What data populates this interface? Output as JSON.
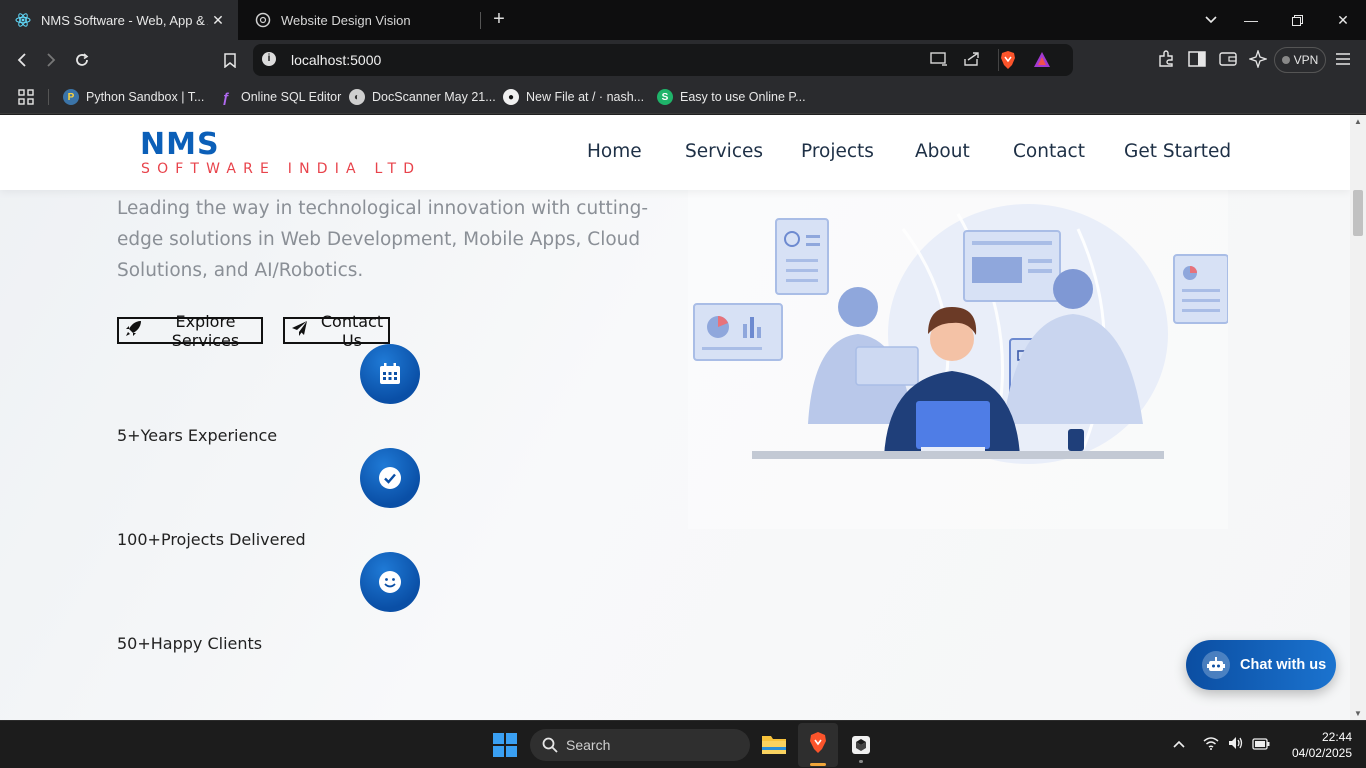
{
  "browser": {
    "tabs": [
      {
        "title": "NMS Software - Web, App & AI",
        "active": true
      },
      {
        "title": "Website Design Vision",
        "active": false
      }
    ],
    "url": "localhost:5000",
    "vpn_label": "VPN",
    "bookmarks": [
      {
        "label": "Python Sandbox | T...",
        "icon": "python-icon"
      },
      {
        "label": "Online SQL Editor",
        "icon": "sql-icon"
      },
      {
        "label": "DocScanner May 21...",
        "icon": "docscanner-icon"
      },
      {
        "label": "New File at / · nash...",
        "icon": "github-icon"
      },
      {
        "label": "Easy to use Online P...",
        "icon": "s-icon"
      }
    ]
  },
  "site": {
    "logo_main": "NMS",
    "logo_sub": "SOFTWARE INDIA LTD",
    "nav": [
      "Home",
      "Services",
      "Projects",
      "About",
      "Contact",
      "Get Started"
    ],
    "hero_text": "Leading the way in technological innovation with cutting-edge solutions in Web Development, Mobile Apps, Cloud Solutions, and AI/Robotics.",
    "buttons": {
      "explore": "Explore Services",
      "contact": "Contact Us"
    },
    "stats": [
      {
        "label": "5+Years Experience",
        "icon": "calendar-icon"
      },
      {
        "label": "100+Projects Delivered",
        "icon": "check-circle-icon"
      },
      {
        "label": "50+Happy Clients",
        "icon": "smile-icon"
      }
    ],
    "chat_label": "Chat with us"
  },
  "taskbar": {
    "search_label": "Search",
    "time": "22:44",
    "date": "04/02/2025"
  },
  "colors": {
    "brand_blue": "#0b5fb8",
    "brand_red": "#e8434b",
    "nav_text": "#1e3046",
    "circle_blue": "#0a4fa6"
  }
}
